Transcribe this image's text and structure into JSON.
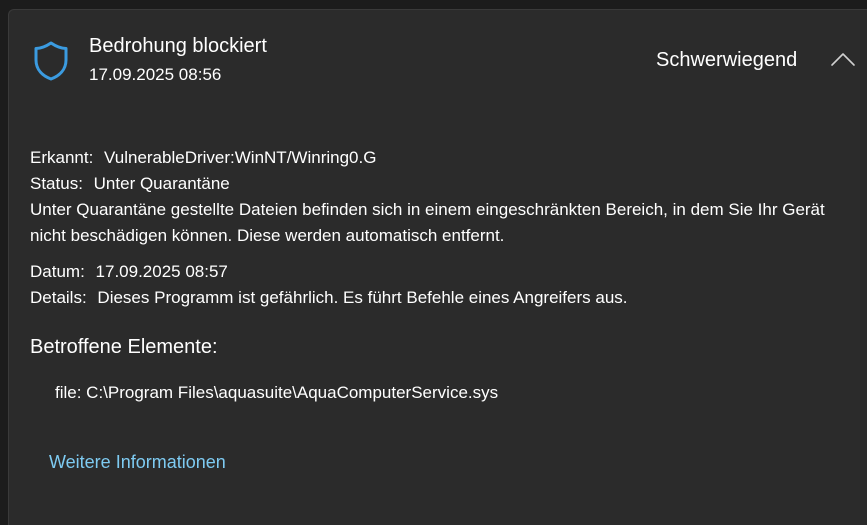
{
  "header": {
    "title": "Bedrohung blockiert",
    "timestamp": "17.09.2025 08:56",
    "severity": "Schwerwiegend",
    "shield_icon": "shield-icon",
    "collapse_icon": "chevron-up-icon",
    "accent_color": "#3b9be0"
  },
  "details": {
    "detected_label": "Erkannt:",
    "detected_value": "VulnerableDriver:WinNT/Winring0.G",
    "status_label": "Status:",
    "status_value": "Unter Quarantäne",
    "quarantine_note": "Unter Quarantäne gestellte Dateien befinden sich in einem eingeschränkten Bereich, in dem Sie Ihr Gerät nicht beschädigen können. Diese werden automatisch entfernt.",
    "date_label": "Datum:",
    "date_value": "17.09.2025 08:57",
    "details_label": "Details:",
    "details_value": "Dieses Programm ist gefährlich. Es führt Befehle eines Angreifers aus."
  },
  "affected": {
    "title": "Betroffene Elemente:",
    "items": [
      "file: C:\\Program Files\\aquasuite\\AquaComputerService.sys"
    ]
  },
  "more_info_link": "Weitere Informationen",
  "link_color": "#7ecbf2"
}
